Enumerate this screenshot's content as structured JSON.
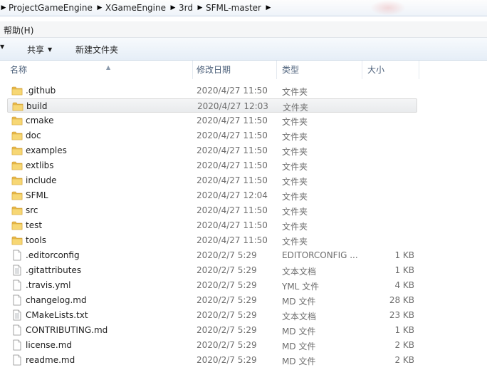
{
  "breadcrumbs": [
    "ProjectGameEngine",
    "XGameEngine",
    "3rd",
    "SFML-master"
  ],
  "menu": {
    "help": "帮助(H)"
  },
  "toolbar": {
    "share": "共享",
    "new_folder": "新建文件夹"
  },
  "columns": {
    "name": "名称",
    "date": "修改日期",
    "type": "类型",
    "size": "大小"
  },
  "files": [
    {
      "name": ".github",
      "date": "2020/4/27 11:50",
      "type": "文件夹",
      "size": "",
      "icon": "folder-icon"
    },
    {
      "name": "build",
      "date": "2020/4/27 12:03",
      "type": "文件夹",
      "size": "",
      "icon": "folder-icon",
      "selected": true
    },
    {
      "name": "cmake",
      "date": "2020/4/27 11:50",
      "type": "文件夹",
      "size": "",
      "icon": "folder-icon"
    },
    {
      "name": "doc",
      "date": "2020/4/27 11:50",
      "type": "文件夹",
      "size": "",
      "icon": "folder-icon"
    },
    {
      "name": "examples",
      "date": "2020/4/27 11:50",
      "type": "文件夹",
      "size": "",
      "icon": "folder-icon"
    },
    {
      "name": "extlibs",
      "date": "2020/4/27 11:50",
      "type": "文件夹",
      "size": "",
      "icon": "folder-icon"
    },
    {
      "name": "include",
      "date": "2020/4/27 11:50",
      "type": "文件夹",
      "size": "",
      "icon": "folder-icon"
    },
    {
      "name": "SFML",
      "date": "2020/4/27 12:04",
      "type": "文件夹",
      "size": "",
      "icon": "folder-icon"
    },
    {
      "name": "src",
      "date": "2020/4/27 11:50",
      "type": "文件夹",
      "size": "",
      "icon": "folder-icon"
    },
    {
      "name": "test",
      "date": "2020/4/27 11:50",
      "type": "文件夹",
      "size": "",
      "icon": "folder-icon"
    },
    {
      "name": "tools",
      "date": "2020/4/27 11:50",
      "type": "文件夹",
      "size": "",
      "icon": "folder-icon"
    },
    {
      "name": ".editorconfig",
      "date": "2020/2/7 5:29",
      "type": "EDITORCONFIG ...",
      "size": "1 KB",
      "icon": "file-icon"
    },
    {
      "name": ".gitattributes",
      "date": "2020/2/7 5:29",
      "type": "文本文档",
      "size": "1 KB",
      "icon": "text-file-icon"
    },
    {
      "name": ".travis.yml",
      "date": "2020/2/7 5:29",
      "type": "YML 文件",
      "size": "4 KB",
      "icon": "file-icon"
    },
    {
      "name": "changelog.md",
      "date": "2020/2/7 5:29",
      "type": "MD 文件",
      "size": "28 KB",
      "icon": "file-icon"
    },
    {
      "name": "CMakeLists.txt",
      "date": "2020/2/7 5:29",
      "type": "文本文档",
      "size": "23 KB",
      "icon": "text-file-icon"
    },
    {
      "name": "CONTRIBUTING.md",
      "date": "2020/2/7 5:29",
      "type": "MD 文件",
      "size": "1 KB",
      "icon": "file-icon"
    },
    {
      "name": "license.md",
      "date": "2020/2/7 5:29",
      "type": "MD 文件",
      "size": "2 KB",
      "icon": "file-icon"
    },
    {
      "name": "readme.md",
      "date": "2020/2/7 5:29",
      "type": "MD 文件",
      "size": "2 KB",
      "icon": "file-icon"
    }
  ]
}
